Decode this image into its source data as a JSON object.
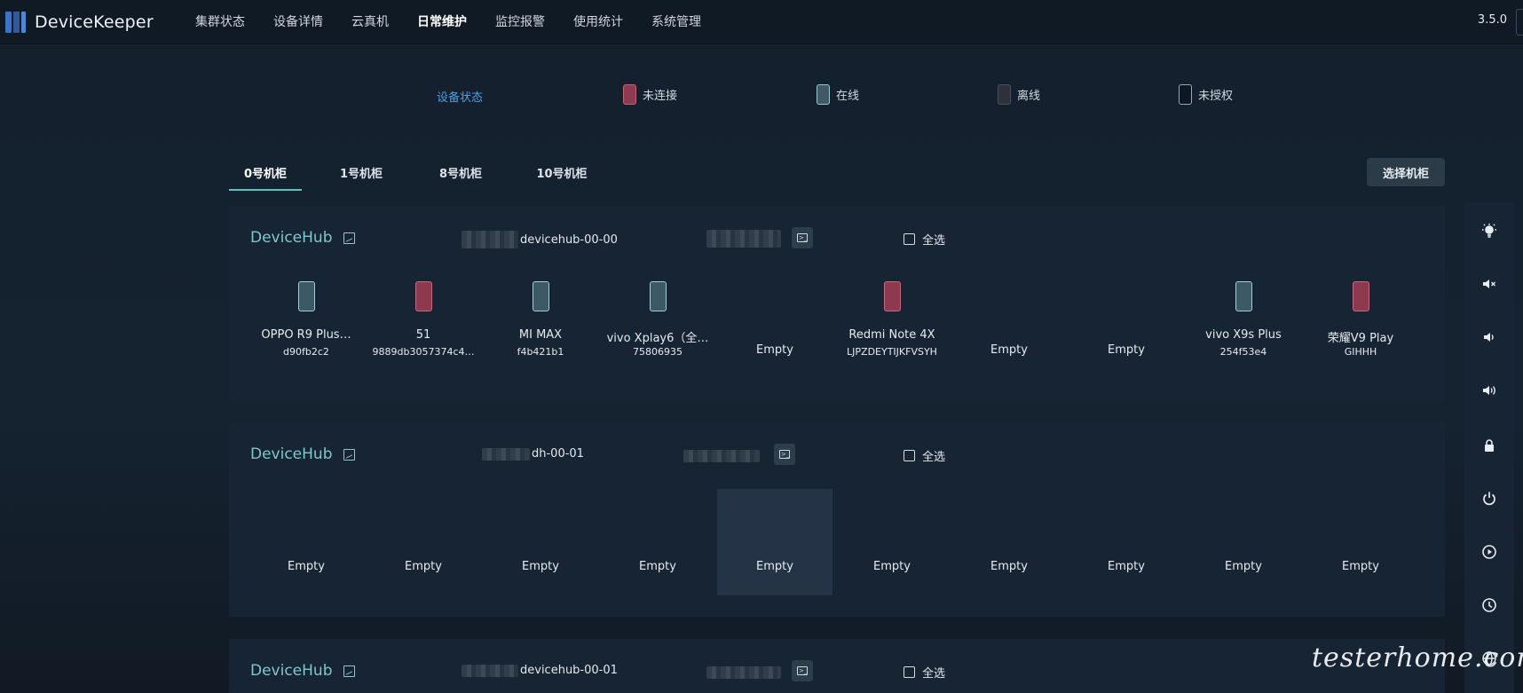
{
  "app": {
    "name": "DeviceKeeper",
    "version": "3.5.0"
  },
  "nav": {
    "items": [
      "集群状态",
      "设备详情",
      "云真机",
      "日常维护",
      "监控报警",
      "使用统计",
      "系统管理"
    ],
    "active_index": 3
  },
  "legend": {
    "title": "设备状态",
    "items": [
      {
        "label": "未连接",
        "color": "#8f3a50"
      },
      {
        "label": "在线",
        "color": "#3f5a67"
      },
      {
        "label": "离线",
        "color": "#2e313a"
      },
      {
        "label": "未授权",
        "color": "#0f1822"
      }
    ]
  },
  "tabs": {
    "items": [
      "0号机柜",
      "1号机柜",
      "8号机柜",
      "10号机柜"
    ],
    "active_index": 0,
    "select_button": "选择机柜"
  },
  "hubs": [
    {
      "title": "DeviceHub",
      "name": "devicehub-00-00",
      "select_all": "全选",
      "slots": [
        {
          "status": "online",
          "name": "OPPO R9 Plus…",
          "serial": "d90fb2c2"
        },
        {
          "status": "unconnected",
          "name": "51",
          "serial": "9889db3057374c4…"
        },
        {
          "status": "online",
          "name": "MI MAX",
          "serial": "f4b421b1"
        },
        {
          "status": "online",
          "name": "vivo Xplay6（全…",
          "serial": "75806935"
        },
        {
          "status": "empty",
          "name": "Empty"
        },
        {
          "status": "unconnected",
          "name": "Redmi Note 4X",
          "serial": "LJPZDEYTIJKFVSYH"
        },
        {
          "status": "empty",
          "name": "Empty"
        },
        {
          "status": "empty",
          "name": "Empty"
        },
        {
          "status": "online",
          "name": "vivo X9s Plus",
          "serial": "254f53e4"
        },
        {
          "status": "unconnected",
          "name": "荣耀V9 Play",
          "serial": "GIHHH"
        }
      ]
    },
    {
      "title": "DeviceHub",
      "name": "dh-00-01",
      "select_all": "全选",
      "slots": [
        {
          "status": "empty",
          "name": "Empty"
        },
        {
          "status": "empty",
          "name": "Empty"
        },
        {
          "status": "empty",
          "name": "Empty"
        },
        {
          "status": "empty",
          "name": "Empty"
        },
        {
          "status": "empty",
          "name": "Empty",
          "hover": true
        },
        {
          "status": "empty",
          "name": "Empty"
        },
        {
          "status": "empty",
          "name": "Empty"
        },
        {
          "status": "empty",
          "name": "Empty"
        },
        {
          "status": "empty",
          "name": "Empty"
        },
        {
          "status": "empty",
          "name": "Empty"
        }
      ]
    },
    {
      "title": "DeviceHub",
      "name": "devicehub-00-01",
      "select_all": "全选",
      "slots": []
    }
  ],
  "toolbar": {
    "icons": [
      "bulb-icon",
      "mute-icon",
      "volume-down-icon",
      "volume-up-icon",
      "lock-icon",
      "power-icon",
      "play-icon",
      "clock-icon",
      "globe-icon"
    ]
  },
  "watermark": "testerhome.com"
}
